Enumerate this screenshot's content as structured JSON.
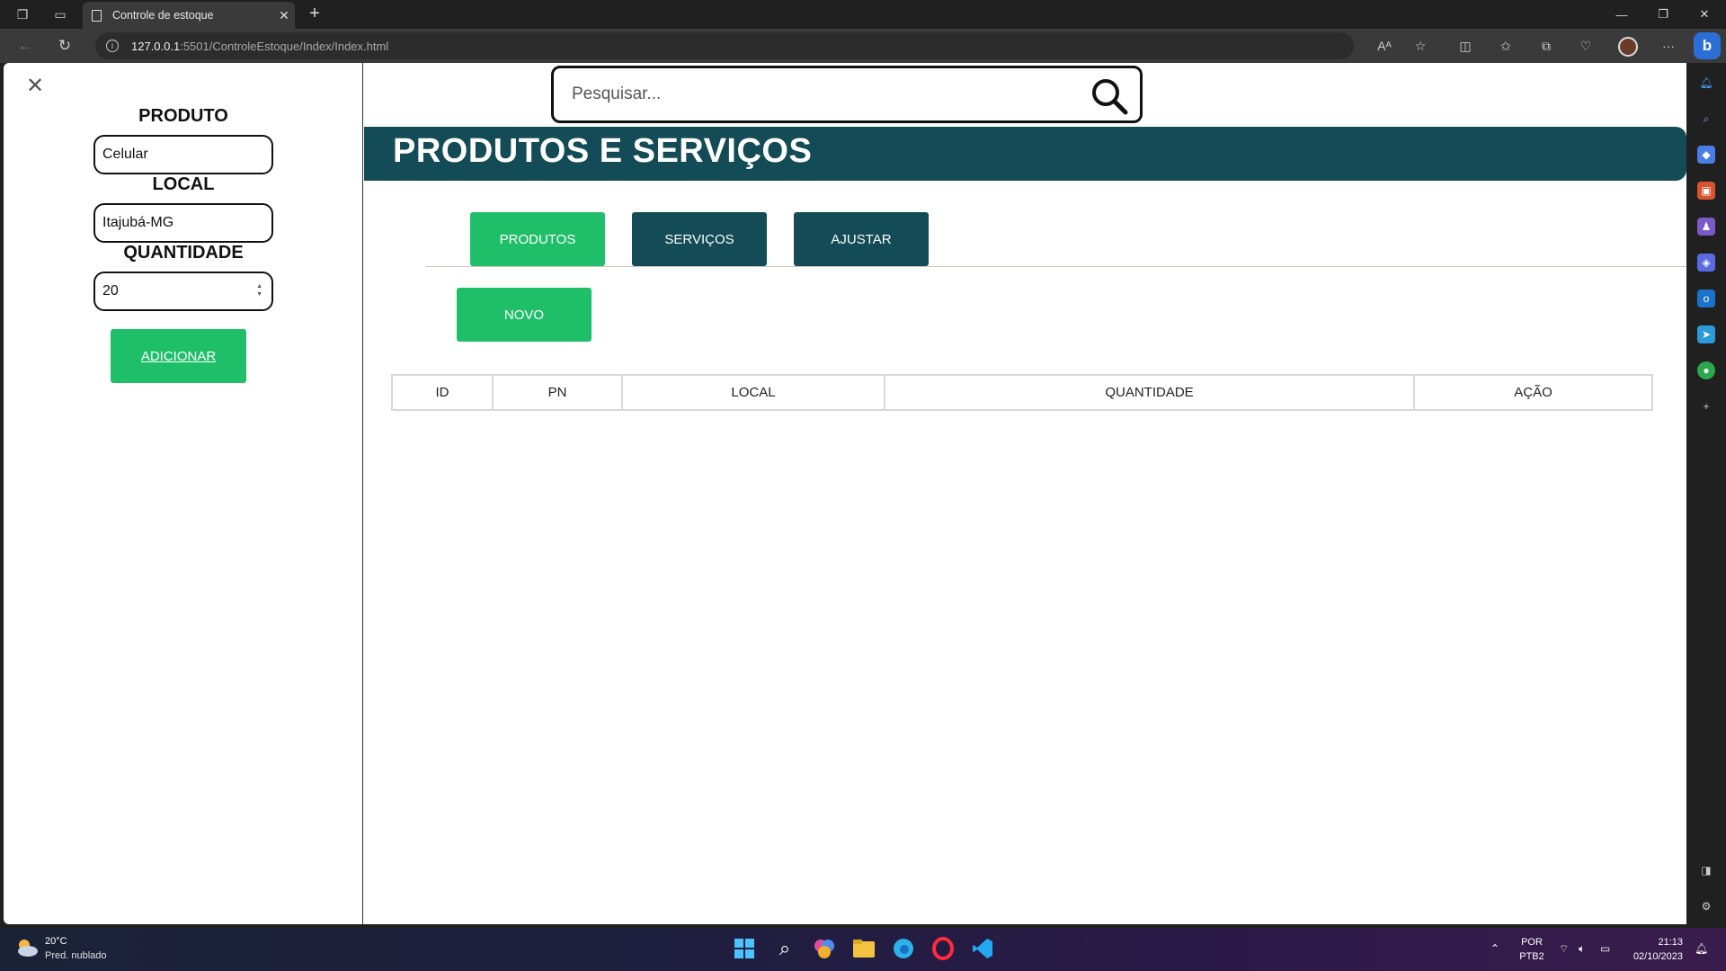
{
  "browser": {
    "tab_title": "Controle de estoque",
    "url_host": "127.0.0.1",
    "url_rest": ":5501/ControleEstoque/Index/Index.html"
  },
  "side_panel": {
    "produto_label": "PRODUTO",
    "produto_value": "Celular",
    "local_label": "LOCAL",
    "local_value": "Itajubá-MG",
    "quantidade_label": "QUANTIDADE",
    "quantidade_value": "20",
    "add_button": "ADICIONAR"
  },
  "main": {
    "search_placeholder": "Pesquisar...",
    "banner_title": "PRODUTOS E SERVIÇOS",
    "tabs": [
      {
        "label": "PRODUTOS",
        "color": "#1fbf6a"
      },
      {
        "label": "SERVIÇOS",
        "color": "#134b56"
      },
      {
        "label": "AJUSTAR",
        "color": "#134b56"
      }
    ],
    "new_button": "NOVO",
    "table_headers": [
      "ID",
      "PN",
      "LOCAL",
      "QUANTIDADE",
      "AÇÃO"
    ]
  },
  "colors": {
    "accent_green": "#1fbf6a",
    "dark_teal": "#134b56"
  },
  "taskbar": {
    "weather_temp": "20°C",
    "weather_desc": "Pred. nublado",
    "lang_top": "POR",
    "lang_bottom": "PTB2",
    "time": "21:13",
    "date": "02/10/2023"
  }
}
